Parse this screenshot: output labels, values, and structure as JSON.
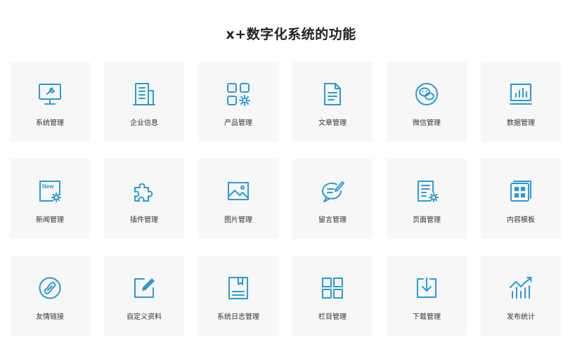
{
  "title": "x+数字化系统的功能",
  "colors": {
    "icon": "#2a9ad6",
    "card_bg": "#f7f7f7",
    "text": "#333333"
  },
  "features": [
    {
      "label": "系统管理",
      "icon": "monitor-settings-icon"
    },
    {
      "label": "企业信息",
      "icon": "office-building-icon"
    },
    {
      "label": "产品管理",
      "icon": "apps-gear-icon"
    },
    {
      "label": "文章管理",
      "icon": "document-icon"
    },
    {
      "label": "微信管理",
      "icon": "wechat-icon"
    },
    {
      "label": "数据管理",
      "icon": "bar-chart-screen-icon"
    },
    {
      "label": "新闻管理",
      "icon": "news-gear-icon",
      "badge": "New"
    },
    {
      "label": "插件管理",
      "icon": "puzzle-icon"
    },
    {
      "label": "图片管理",
      "icon": "image-icon"
    },
    {
      "label": "留言管理",
      "icon": "message-pen-icon"
    },
    {
      "label": "页面管理",
      "icon": "page-gear-icon"
    },
    {
      "label": "内容模板",
      "icon": "template-icon"
    },
    {
      "label": "友情链接",
      "icon": "link-icon"
    },
    {
      "label": "自定义资料",
      "icon": "edit-icon"
    },
    {
      "label": "系统日志管理",
      "icon": "log-book-icon"
    },
    {
      "label": "栏目管理",
      "icon": "columns-grid-icon"
    },
    {
      "label": "下载管理",
      "icon": "download-icon"
    },
    {
      "label": "发布统计",
      "icon": "trend-chart-icon"
    }
  ]
}
